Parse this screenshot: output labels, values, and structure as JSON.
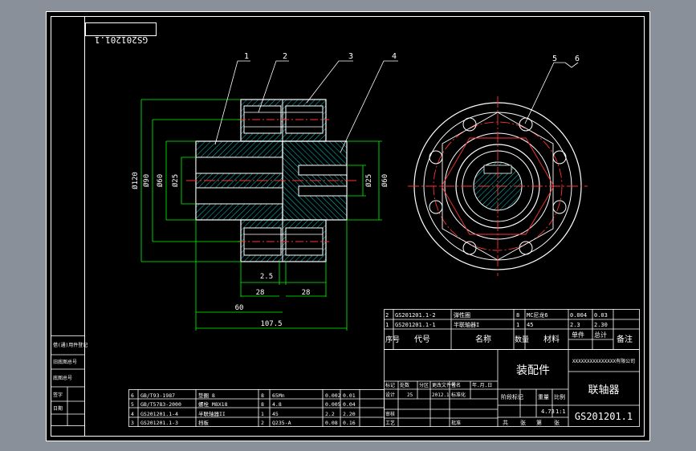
{
  "drawing_no": "GS201201.1",
  "title_block": {
    "part_name": "联轴器",
    "drawing_no": "GS201201.1",
    "assembly_label": "装配件",
    "company": "XXXXXXXXXXXXXXX有限公司",
    "scale": "1:1",
    "weight": "4.73"
  },
  "balloons": [
    "1",
    "2",
    "3",
    "4",
    "5",
    "6"
  ],
  "dimensions": {
    "d1": "Ø120",
    "d2": "Ø90",
    "d3": "Ø60",
    "d4": "Ø25",
    "d5": "Ø25",
    "d6": "Ø60",
    "l1": "2.5",
    "l2": "28",
    "l3": "28",
    "l4": "60",
    "l5": "107.5"
  },
  "bom_upper": {
    "headers": [
      "序号",
      "代号",
      "名称",
      "数量",
      "材料",
      "单件",
      "总计",
      "备注"
    ],
    "rows": [
      [
        "2",
        "GS201201.1-2",
        "弹性圈",
        "8",
        "MC尼龙6",
        "0.004",
        "0.03",
        ""
      ],
      [
        "1",
        "GS201201.1-1",
        "半联轴器I",
        "1",
        "45",
        "2.3",
        "2.30",
        ""
      ]
    ]
  },
  "bom_lower": {
    "rows": [
      [
        "6",
        "GB/T93-1987",
        "垫圈 8",
        "8",
        "65Mn",
        "0.002",
        "0.01"
      ],
      [
        "5",
        "GB/T5783-2000",
        "螺栓 M8X18",
        "8",
        "4.8",
        "0.005",
        "0.04"
      ],
      [
        "4",
        "GS201201.1-4",
        "半联轴器II",
        "1",
        "45",
        "2.2",
        "2.20"
      ],
      [
        "3",
        "GS201201.1-3",
        "挡板",
        "2",
        "Q235-A",
        "0.08",
        "0.16"
      ]
    ]
  },
  "revision_labels": [
    "标记",
    "处数",
    "分区",
    "更改文件号",
    "签名",
    "年.月.日"
  ],
  "approval_labels": [
    "设计",
    "审核",
    "工艺",
    "标准化",
    "批准"
  ],
  "approval_values": {
    "designer": "25",
    "date": "2012.1"
  },
  "stage_labels": [
    "阶段标记",
    "重量",
    "比例"
  ],
  "sheet_labels": [
    "共",
    "张",
    "第",
    "张"
  ],
  "side_labels": [
    "借(通)用件登记",
    "旧底图总号",
    "底图总号",
    "签字",
    "日期"
  ],
  "colors": {
    "sheet_bg": "#000000",
    "outline": "#ffffff",
    "dimension": "#00ff00",
    "centerline": "#ff3333",
    "hatch": "#00cccc",
    "text_yellow": "#ffff66"
  }
}
